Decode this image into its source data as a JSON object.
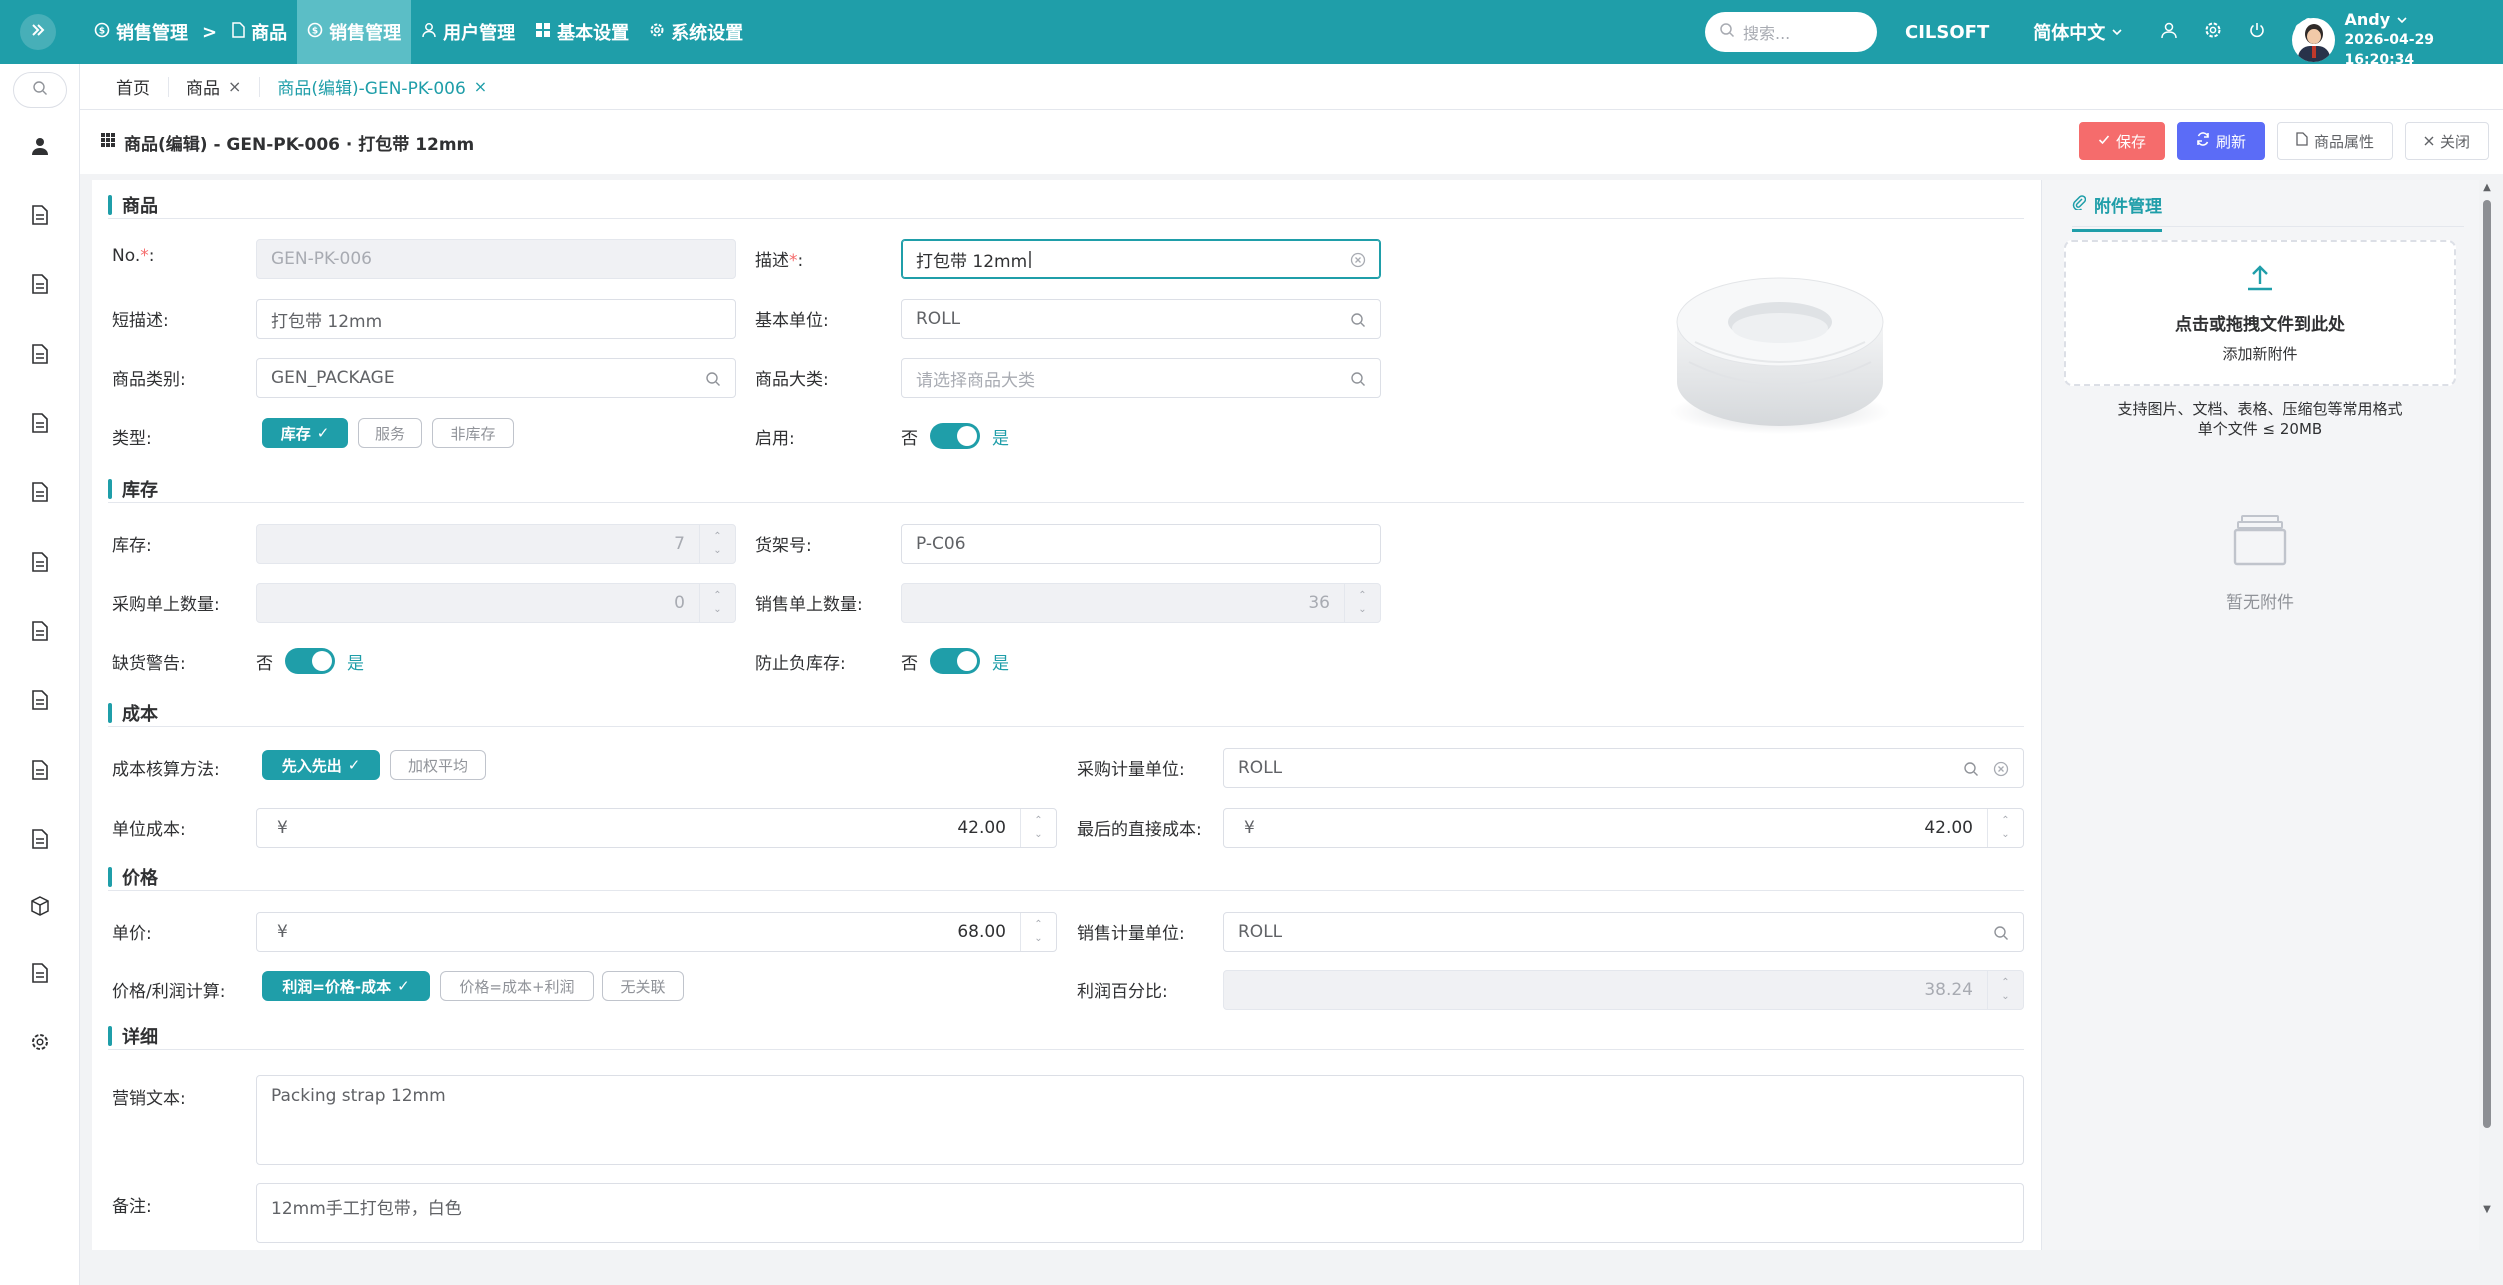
{
  "header": {
    "nav": [
      {
        "label": "销售管理",
        "icon": "dollar-circle-icon"
      },
      {
        "label": "商品",
        "icon": "document-icon"
      },
      {
        "label": "销售管理",
        "icon": "dollar-circle-icon",
        "active": true
      },
      {
        "label": "用户管理",
        "icon": "user-icon"
      },
      {
        "label": "基本设置",
        "icon": "grid-icon"
      },
      {
        "label": "系统设置",
        "icon": "gear-icon"
      }
    ],
    "breadcrumb_sep": ">",
    "search_placeholder": "搜索...",
    "brand": "CILSOFT",
    "language": "简体中文",
    "user_name": "Andy",
    "datetime": "2026-04-29 16:20:34"
  },
  "tabs": [
    {
      "label": "首页",
      "closable": false
    },
    {
      "label": "商品",
      "closable": true
    },
    {
      "label": "商品(编辑)-GEN-PK-006",
      "closable": true,
      "active": true
    }
  ],
  "tab_close": "×",
  "page": {
    "title": "商品(编辑) - GEN-PK-006 · 打包带 12mm",
    "actions": {
      "save": "保存",
      "refresh": "刷新",
      "properties": "商品属性",
      "close": "关闭"
    }
  },
  "form": {
    "sections": {
      "product": "商品",
      "inventory": "库存",
      "cost": "成本",
      "price": "价格",
      "detail": "详细"
    },
    "required_mark": "*",
    "colon": ":",
    "no": {
      "label": "No.",
      "value": "GEN-PK-006"
    },
    "description": {
      "label": "描述",
      "value": "打包带 12mm"
    },
    "short_desc": {
      "label": "短描述:",
      "value": "打包带 12mm"
    },
    "base_unit": {
      "label": "基本单位:",
      "value": "ROLL"
    },
    "category": {
      "label": "商品类别:",
      "value": "GEN_PACKAGE"
    },
    "major_category": {
      "label": "商品大类:",
      "placeholder": "请选择商品大类"
    },
    "type": {
      "label": "类型:",
      "options": [
        "库存",
        "服务",
        "非库存"
      ],
      "selected": "库存"
    },
    "enabled": {
      "label": "启用:",
      "off": "否",
      "on": "是",
      "value": true
    },
    "stock": {
      "label": "库存:",
      "value": "7"
    },
    "shelf_no": {
      "label": "货架号:",
      "value": "P-C06"
    },
    "purchase_qty": {
      "label": "采购单上数量:",
      "value": "0"
    },
    "sales_qty": {
      "label": "销售单上数量:",
      "value": "36"
    },
    "shortage_warning": {
      "label": "缺货警告:",
      "off": "否",
      "on": "是",
      "value": true
    },
    "prevent_negative": {
      "label": "防止负库存:",
      "off": "否",
      "on": "是",
      "value": true
    },
    "costing_method": {
      "label": "成本核算方法:",
      "options": [
        "先入先出",
        "加权平均"
      ],
      "selected": "先入先出"
    },
    "purchase_unit": {
      "label": "采购计量单位:",
      "value": "ROLL"
    },
    "unit_cost": {
      "label": "单位成本:",
      "currency": "¥",
      "value": "42.00"
    },
    "last_direct_cost": {
      "label": "最后的直接成本:",
      "currency": "¥",
      "value": "42.00"
    },
    "unit_price": {
      "label": "单价:",
      "currency": "¥",
      "value": "68.00"
    },
    "sales_unit": {
      "label": "销售计量单位:",
      "value": "ROLL"
    },
    "price_profit_calc": {
      "label": "价格/利润计算:",
      "options": [
        "利润=价格-成本",
        "价格=成本+利润",
        "无关联"
      ],
      "selected": "利润=价格-成本"
    },
    "profit_percent": {
      "label": "利润百分比:",
      "value": "38.24"
    },
    "marketing_text": {
      "label": "营销文本:",
      "value": "Packing strap 12mm"
    },
    "remark": {
      "label": "备注:",
      "value": "12mm手工打包带，白色"
    },
    "check_mark": "✓"
  },
  "attachments": {
    "tab_label": "附件管理",
    "drop_title": "点击或拖拽文件到此处",
    "drop_sub": "添加新附件",
    "note_line1": "支持图片、文档、表格、压缩包等常用格式",
    "note_line2": "单个文件 ≤ 20MB",
    "empty": "暂无附件"
  },
  "colors": {
    "primary": "#1f9ea9",
    "save": "#f56c6c",
    "refresh": "#5b6cf7"
  }
}
